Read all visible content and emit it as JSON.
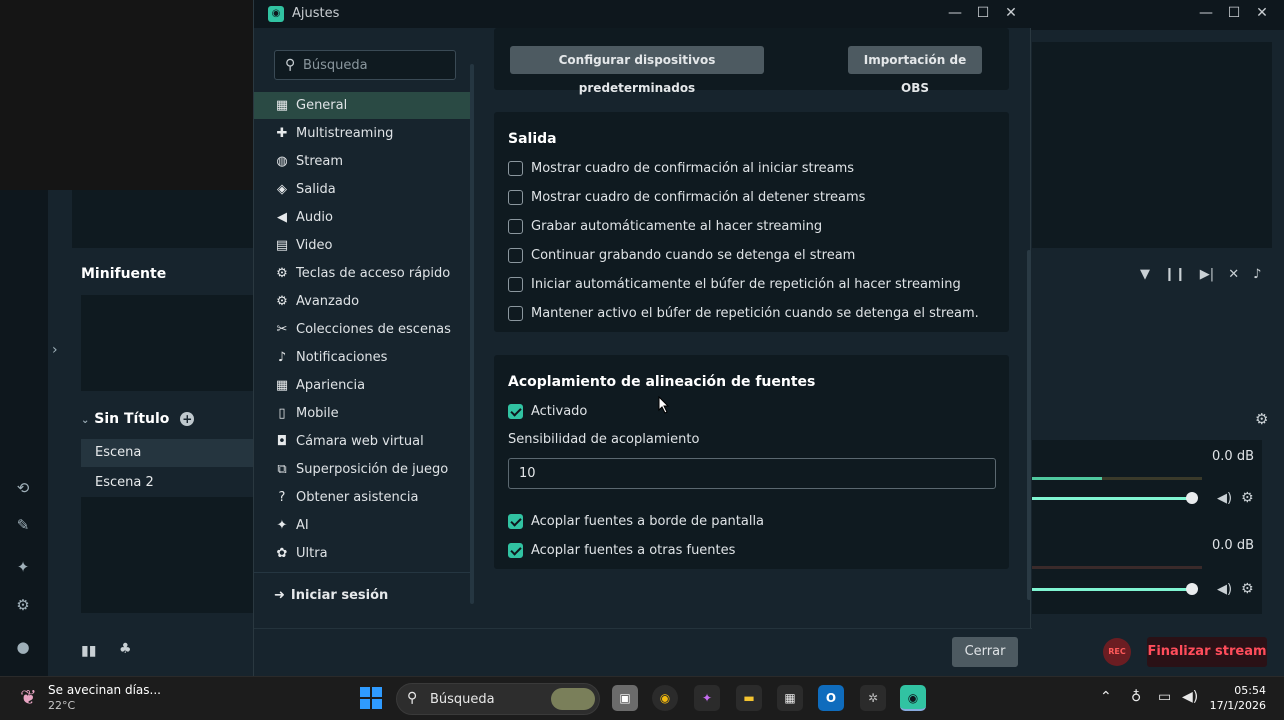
{
  "background_app": {
    "minifuente_label": "Minifuente",
    "scene_collection_title": "Sin Título",
    "scenes": [
      "Escena",
      "Escena 2"
    ],
    "mixer": [
      {
        "db": "0.0 dB"
      },
      {
        "db": "0.0 dB"
      }
    ],
    "rec_label": "REC",
    "finalizar_label": "Finalizar stream"
  },
  "settings": {
    "title": "Ajustes",
    "search_placeholder": "Búsqueda",
    "nav": [
      {
        "label": "General",
        "icon": "grid-icon",
        "active": true
      },
      {
        "label": "Multistreaming",
        "icon": "multistream-icon"
      },
      {
        "label": "Stream",
        "icon": "globe-icon"
      },
      {
        "label": "Salida",
        "icon": "output-icon"
      },
      {
        "label": "Audio",
        "icon": "speaker-icon"
      },
      {
        "label": "Video",
        "icon": "film-icon"
      },
      {
        "label": "Teclas de acceso rápido",
        "icon": "gear-icon"
      },
      {
        "label": "Avanzado",
        "icon": "gears-icon"
      },
      {
        "label": "Colecciones de escenas",
        "icon": "collections-icon"
      },
      {
        "label": "Notificaciones",
        "icon": "bell-icon"
      },
      {
        "label": "Apariencia",
        "icon": "palette-icon"
      },
      {
        "label": "Mobile",
        "icon": "mobile-icon"
      },
      {
        "label": "Cámara web virtual",
        "icon": "camera-icon"
      },
      {
        "label": "Superposición de juego",
        "icon": "overlay-icon"
      },
      {
        "label": "Obtener asistencia",
        "icon": "help-icon"
      },
      {
        "label": "AI",
        "icon": "sparkle-icon"
      },
      {
        "label": "Ultra",
        "icon": "ultra-icon"
      }
    ],
    "login_label": "Iniciar sesión",
    "top_buttons": {
      "configure": "Configurar dispositivos predeterminados",
      "obs_import": "Importación de OBS"
    },
    "salida": {
      "title": "Salida",
      "options": [
        {
          "label": "Mostrar cuadro de confirmación al iniciar streams",
          "checked": false
        },
        {
          "label": "Mostrar cuadro de confirmación al detener streams",
          "checked": false
        },
        {
          "label": "Grabar automáticamente al hacer streaming",
          "checked": false
        },
        {
          "label": "Continuar grabando cuando se detenga el stream",
          "checked": false
        },
        {
          "label": "Iniciar automáticamente el búfer de repetición al hacer streaming",
          "checked": false
        },
        {
          "label": "Mantener activo el búfer de repetición cuando se detenga el stream.",
          "checked": false
        }
      ]
    },
    "snapping": {
      "title": "Acoplamiento de alineación de fuentes",
      "enabled_label": "Activado",
      "sensitivity_label": "Sensibilidad de acoplamiento",
      "sensitivity_value": "10",
      "edge_label": "Acoplar fuentes a borde de pantalla",
      "other_label": "Acoplar fuentes a otras fuentes"
    },
    "close_label": "Cerrar"
  },
  "taskbar": {
    "weather_line1": "Se avecinan días...",
    "weather_line2": "22°C",
    "search_label": "Búsqueda",
    "time": "05:54",
    "date": "17/1/2026"
  },
  "colors": {
    "accent": "#31c3a2",
    "danger": "#ff4d5b",
    "panel": "#0f1a20",
    "window": "#17242d"
  }
}
